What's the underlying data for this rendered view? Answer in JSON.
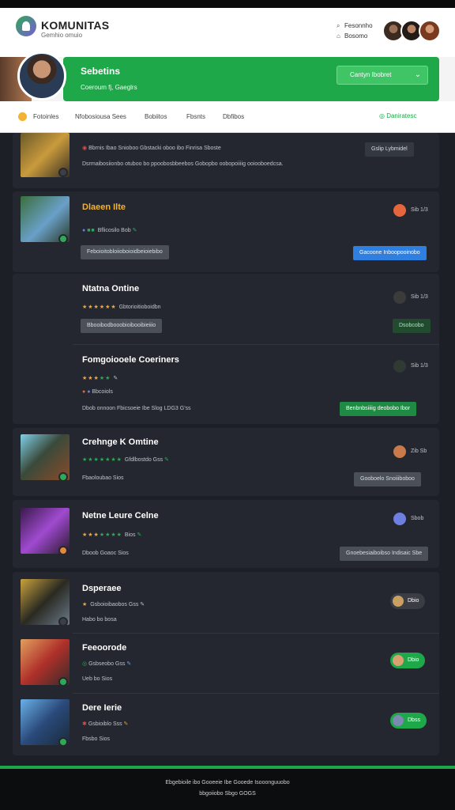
{
  "app": {
    "brand": "KOMUNITAS",
    "brand_sub": "Gemhio omuio",
    "links": [
      {
        "icon": "search-icon",
        "label": "Fesonnho"
      },
      {
        "icon": "bookmark-icon",
        "label": "Bosomo"
      }
    ]
  },
  "profile": {
    "name": "Sebetins",
    "subtitle": "Coeroum fj, Gaeglrs",
    "action_label": "Cantyn Ibobret"
  },
  "tabs": [
    "Fotoinles",
    "Nfobosiousa Sees",
    "Bobiitos",
    "Fbsnts",
    "Dbfibos"
  ],
  "tab_action": "Daniratesc",
  "cards": [
    {
      "title": "",
      "meta": "Bbrnis Ibao Snioboo  Gbstacki oboo ibo Finrisa Sboste",
      "desc": "Dsrmaibosiionbo otuboo bo ppoobosbbeebos Gobopbo oobopoiiiig ooiooboedcsa.",
      "right_chip": "Gslip Lybmidel"
    },
    {
      "title": "Dlaeen Ilte",
      "meta": "Bflicosilo  Bob",
      "chip_left": "Feboioitobloiioboioidbeioiebibo",
      "right_txt": "Sib 1/3",
      "chip_right": "Gacoone Inboopooinobo"
    },
    {
      "title": "Ntatna Ontine",
      "meta": "Gbtorioitioboidbn",
      "chip_left": "Bbooibodbooobioibooibieiiio",
      "right_txt": "Sib 1/3",
      "chip_right": "Dsobcobo"
    },
    {
      "title": "Fomgoiooele Coeriners",
      "meta": "Bbcoiols",
      "desc": "Dbob onnoon  Fbicsoeie Ibe Slog LDG3 G'ss",
      "right_txt": "Sib 1/3",
      "chip_right": "Benbnbsiiiig deobobo Ibor"
    },
    {
      "title": "Crehnge K Omtine",
      "meta": "Gfdlbostdo  Gss",
      "meta2": "Fbaoloubao Sios",
      "right_txt": "Zib Sb",
      "chip_right": "Gooboelo Snoiiiboboo"
    },
    {
      "title": "Netne Leure Celne",
      "meta": "Bios",
      "meta2": "Dboob Goaoc Sios",
      "right_txt": "Sbob",
      "chip_right": "Gnoebesiaiboibso Indisaic Sbe"
    },
    {
      "title": "Dsperaee",
      "meta": "Gsboioibaobos Gss",
      "meta2": "Habo bo bosa",
      "pill": "Dbio"
    },
    {
      "title": "Feeoorode",
      "meta": "Gsbseobo Gss",
      "meta2": "Ueb bo Sios",
      "pill": "Dbio"
    },
    {
      "title": "Dere Ierie",
      "meta": "Gsbioiblo Sss",
      "meta2": "Fbsbo Sios",
      "pill": "Dbss"
    }
  ],
  "footer": {
    "line1": "Ebgebioile ibo Gooeeie Ibe Gooede Isooonguuobo",
    "line2": "bbgoiiobo Sbgo GOGS"
  }
}
